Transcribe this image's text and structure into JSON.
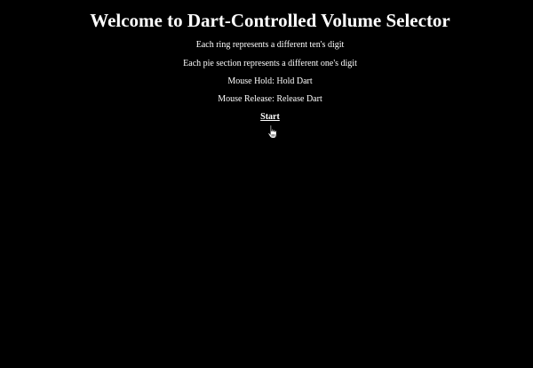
{
  "page": {
    "title": "Welcome to Dart-Controlled Volume Selector",
    "instructions": [
      "Each ring represents a different ten's digit",
      "Each pie section represents a different one's digit",
      "Mouse Hold: Hold Dart",
      "Mouse Release: Release Dart"
    ],
    "start_label": "Start"
  },
  "colors": {
    "background": "#000000",
    "text": "#ffffff"
  },
  "icons": {
    "cursor": "hand-pointer-icon"
  }
}
